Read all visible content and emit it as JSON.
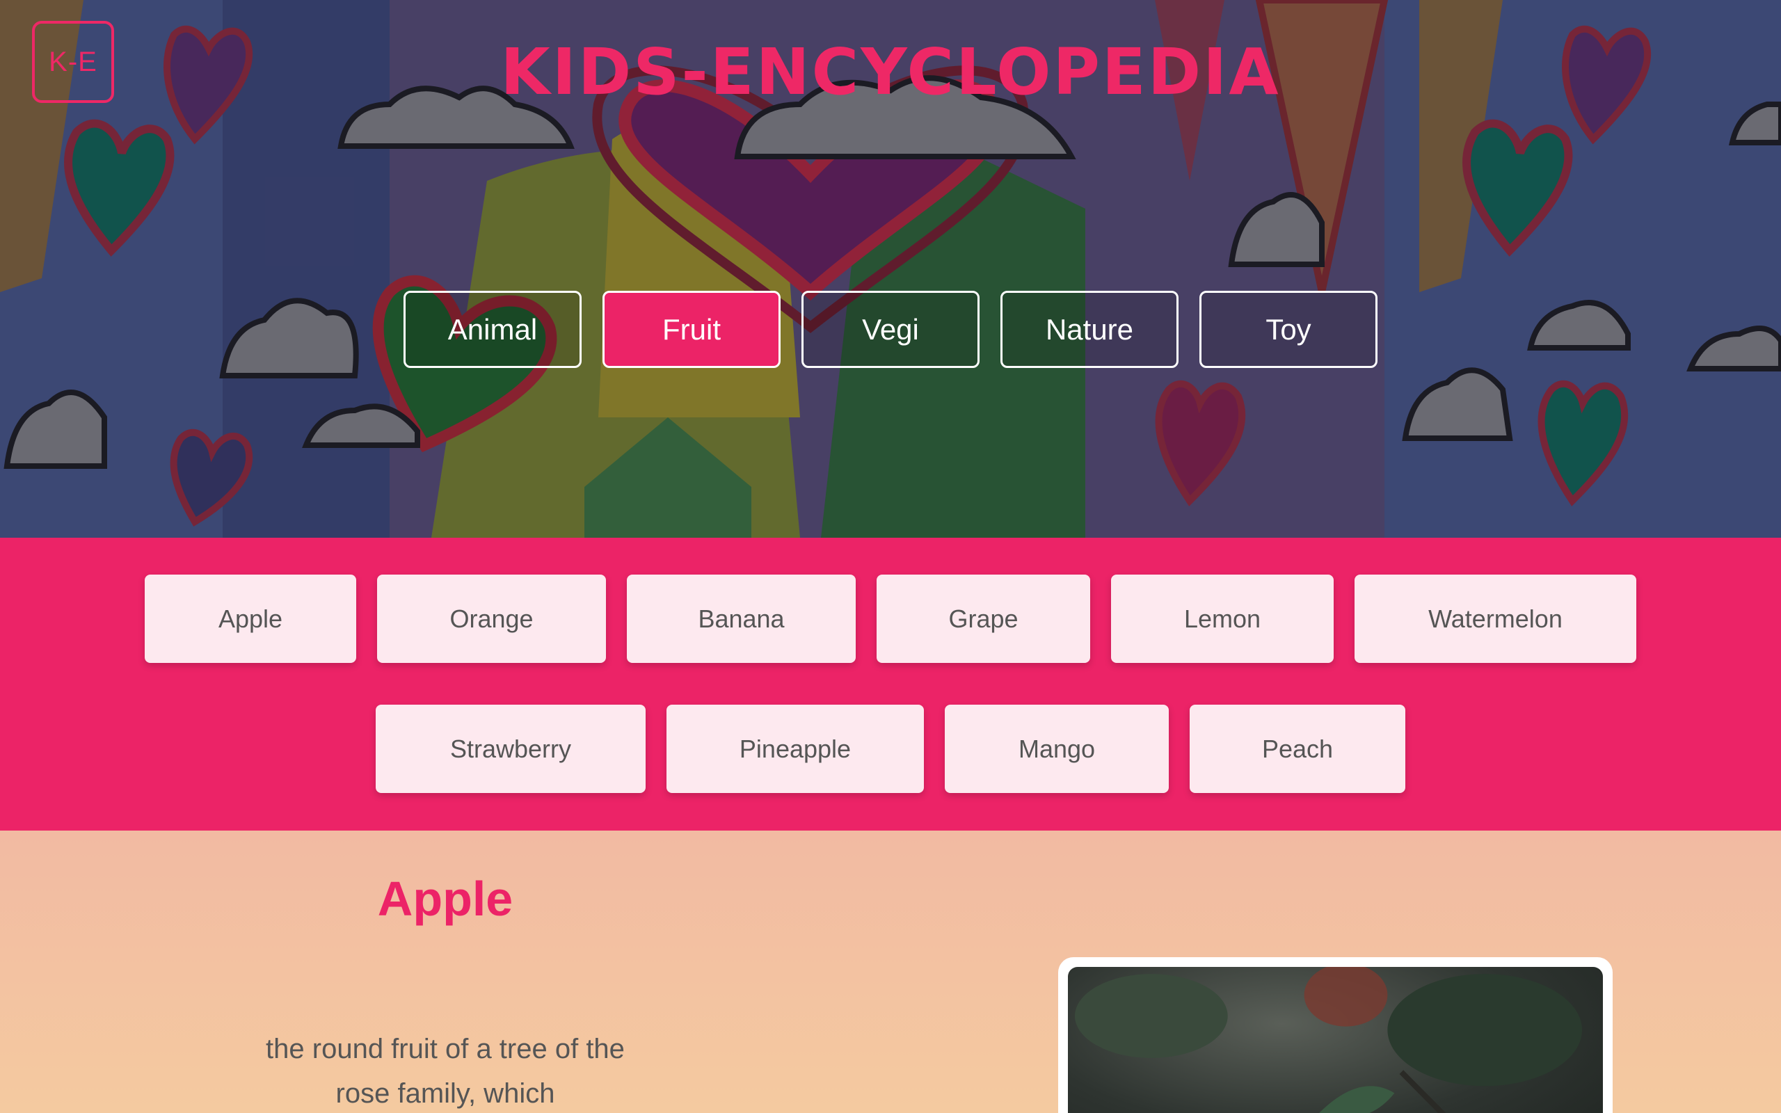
{
  "brand": {
    "logo_text": "K-E",
    "title": "KIDS-ENCYCLOPEDIA"
  },
  "categories": [
    {
      "label": "Animal",
      "active": false
    },
    {
      "label": "Fruit",
      "active": true
    },
    {
      "label": "Vegi",
      "active": false
    },
    {
      "label": "Nature",
      "active": false
    },
    {
      "label": "Toy",
      "active": false
    }
  ],
  "items": {
    "row1": [
      "Apple",
      "Orange",
      "Banana",
      "Grape",
      "Lemon",
      "Watermelon"
    ],
    "row2": [
      "Strawberry",
      "Pineapple",
      "Mango",
      "Peach"
    ]
  },
  "detail": {
    "title": "Apple",
    "description": "the round fruit of a tree of the rose family, which"
  },
  "colors": {
    "accent": "#ec2367",
    "item_bg": "#fde9ef",
    "detail_bg": "#f3c2a6"
  }
}
